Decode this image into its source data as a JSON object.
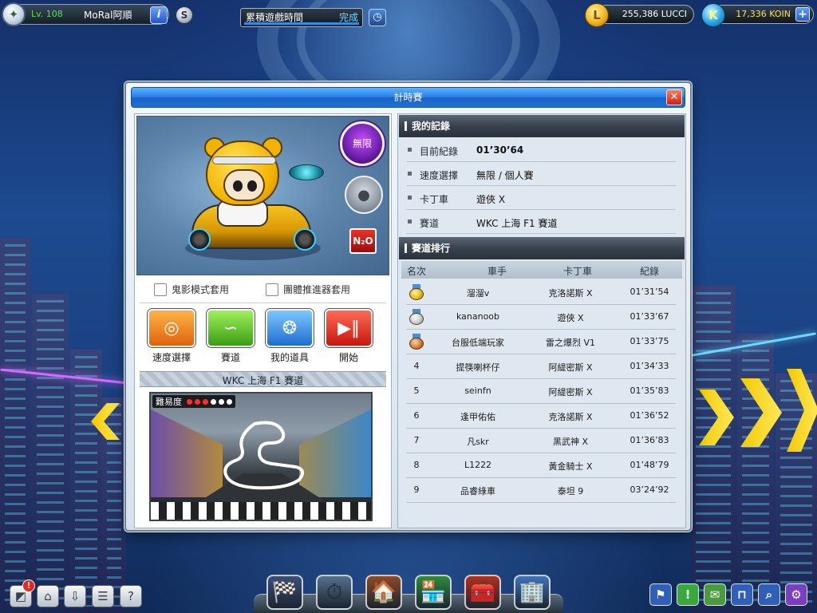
{
  "player": {
    "level": "Lv. 108",
    "name": "MoRal阿順",
    "avatar_icon": "medal-avatar-icon"
  },
  "quest": {
    "label": "累積遊戲時間",
    "status": "完成",
    "progress": 1.0
  },
  "currency": {
    "lucci": {
      "value": "255,386 LUCCI",
      "symbol": "L"
    },
    "koin": {
      "value": "17,336 KOIN",
      "symbol": "K"
    }
  },
  "dialog": {
    "title": "計時賽",
    "kart": {
      "speed_badge": "無限",
      "n2o": "N₂O"
    },
    "options": [
      "鬼影模式套用",
      "團體推進器套用"
    ],
    "actions": [
      {
        "label": "速度選擇",
        "icon": "speed-gauge-icon"
      },
      {
        "label": "賽道",
        "icon": "track-icon"
      },
      {
        "label": "我的道具",
        "icon": "item-icon"
      },
      {
        "label": "開始",
        "icon": "play-pause-icon"
      }
    ],
    "track_name": "WKC 上海 F1 賽道",
    "difficulty": {
      "label": "難易度",
      "level": 3,
      "max": 6
    },
    "my_record": {
      "heading": "我的記錄",
      "rows": [
        {
          "key": "目前紀錄",
          "value": "01’30’64"
        },
        {
          "key": "速度選擇",
          "value": "無限 / 個人賽"
        },
        {
          "key": "卡丁車",
          "value": "遊俠 X"
        },
        {
          "key": "賽道",
          "value": "WKC 上海 F1 賽道"
        }
      ]
    },
    "ranking": {
      "heading": "賽道排行",
      "columns": [
        "名次",
        "車手",
        "卡丁車",
        "紀錄"
      ],
      "rows": [
        {
          "rank": "1",
          "medal": "gold",
          "driver": "溜溜v",
          "kart": "克洛諾斯 X",
          "time": "01’31’54"
        },
        {
          "rank": "2",
          "medal": "silver",
          "driver": "kananoob",
          "kart": "遊俠 X",
          "time": "01’33’67"
        },
        {
          "rank": "3",
          "medal": "bronze",
          "driver": "台服低端玩家",
          "kart": "雷之爆烈 V1",
          "time": "01’33’75"
        },
        {
          "rank": "4",
          "medal": "",
          "driver": "提筷喇杯仔",
          "kart": "阿緹密斯 X",
          "time": "01’34’33"
        },
        {
          "rank": "5",
          "medal": "",
          "driver": "seinfn",
          "kart": "阿緹密斯 X",
          "time": "01’35’83"
        },
        {
          "rank": "6",
          "medal": "",
          "driver": "逢甲佑佑",
          "kart": "克洛諾斯 X",
          "time": "01’36’52"
        },
        {
          "rank": "7",
          "medal": "",
          "driver": "凡skr",
          "kart": "黑武神 X",
          "time": "01’36’83"
        },
        {
          "rank": "8",
          "medal": "",
          "driver": "L1222",
          "kart": "黃金騎士 X",
          "time": "01’48’79"
        },
        {
          "rank": "9",
          "medal": "",
          "driver": "品睿綠車",
          "kart": "泰坦 9",
          "time": "03’24’92"
        }
      ]
    }
  },
  "bottom_left": [
    {
      "icon": "map-icon",
      "glyph": "◩"
    },
    {
      "icon": "home-icon",
      "glyph": "⌂"
    },
    {
      "icon": "inbox-icon",
      "glyph": "⇩"
    },
    {
      "icon": "notes-icon",
      "glyph": "☰"
    },
    {
      "icon": "help-icon",
      "glyph": "?"
    }
  ],
  "alert_badge": "!",
  "dock": [
    {
      "icon": "kart-garage-icon",
      "glyph": "🏁"
    },
    {
      "icon": "speedometer-icon",
      "glyph": "⏱"
    },
    {
      "icon": "garage-icon",
      "glyph": "🏠"
    },
    {
      "icon": "shop-icon",
      "glyph": "🏪"
    },
    {
      "icon": "toolbox-icon",
      "glyph": "🧰"
    },
    {
      "icon": "building-icon",
      "glyph": "🏢"
    }
  ],
  "bottom_right": [
    {
      "icon": "flag-icon",
      "glyph": "⚑",
      "color": "#2f5fb8"
    },
    {
      "icon": "exclamation-icon",
      "glyph": "!",
      "color": "#3aa83a"
    },
    {
      "icon": "chat-icon",
      "glyph": "✉",
      "color": "#4b9a3e"
    },
    {
      "icon": "signpost-icon",
      "glyph": "⊓",
      "color": "#2f5fb8"
    },
    {
      "icon": "search-icon",
      "glyph": "⌕",
      "color": "#2f5fb8"
    },
    {
      "icon": "settings-icon",
      "glyph": "⚙",
      "color": "#7a3fc0"
    }
  ]
}
